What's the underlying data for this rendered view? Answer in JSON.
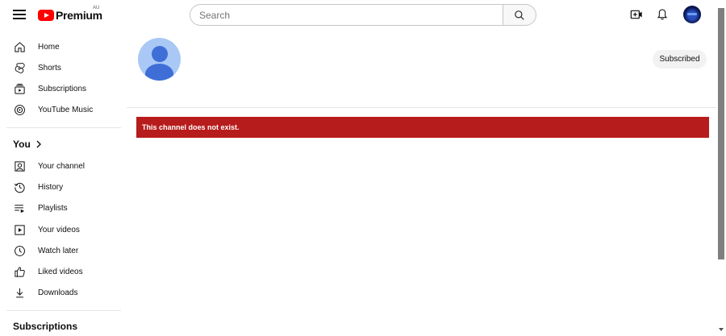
{
  "header": {
    "logo_word": "Premium",
    "region": "AU",
    "search": {
      "placeholder": "Search",
      "value": ""
    }
  },
  "sidebar": {
    "main_items": [
      {
        "label": "Home",
        "icon": "home-icon"
      },
      {
        "label": "Shorts",
        "icon": "shorts-icon"
      },
      {
        "label": "Subscriptions",
        "icon": "subscriptions-icon"
      },
      {
        "label": "YouTube Music",
        "icon": "youtube-music-icon"
      }
    ],
    "you_heading": "You",
    "you_items": [
      {
        "label": "Your channel",
        "icon": "your-channel-icon"
      },
      {
        "label": "History",
        "icon": "history-icon"
      },
      {
        "label": "Playlists",
        "icon": "playlists-icon"
      },
      {
        "label": "Your videos",
        "icon": "your-videos-icon"
      },
      {
        "label": "Watch later",
        "icon": "watch-later-icon"
      },
      {
        "label": "Liked videos",
        "icon": "liked-videos-icon"
      },
      {
        "label": "Downloads",
        "icon": "downloads-icon"
      }
    ],
    "subscriptions_heading": "Subscriptions"
  },
  "channel": {
    "subscribe_label": "Subscribed",
    "error_message": "This channel does not exist."
  },
  "colors": {
    "brand_red": "#ff0000",
    "error_red": "#b71c1c",
    "avatar_bg": "#a9c8f5",
    "avatar_fg": "#3f6fd6"
  }
}
